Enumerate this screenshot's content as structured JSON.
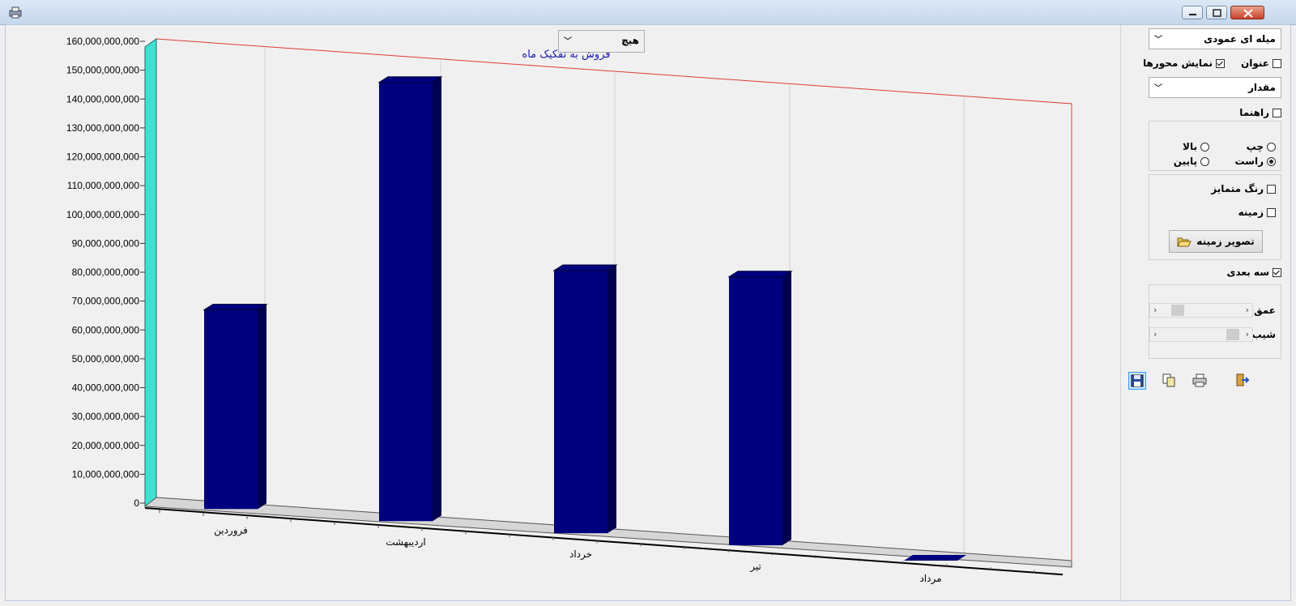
{
  "colors": {
    "bar": "#00007f",
    "bar_side": "#000050",
    "bar_top": "#00007f",
    "axis_wall": "#40e0d0",
    "outline": "#e03c31"
  },
  "window": {
    "icons": [
      "minimize-icon",
      "restore-icon",
      "close-icon"
    ]
  },
  "chart": {
    "group_dropdown": {
      "value": "هیچ"
    },
    "title": "فروش به تفکیک ماه"
  },
  "chart_data": {
    "type": "bar",
    "title": "فروش به تفکیک ماه",
    "categories": [
      "فروردین",
      "اردیبهشت",
      "خرداد",
      "تیر",
      "مرداد"
    ],
    "series": [
      {
        "values": [
          69000000000,
          152000000000,
          91000000000,
          93000000000,
          0
        ]
      }
    ],
    "yticks": [
      "0",
      "10,000,000,000",
      "20,000,000,000",
      "30,000,000,000",
      "40,000,000,000",
      "50,000,000,000",
      "60,000,000,000",
      "70,000,000,000",
      "80,000,000,000",
      "90,000,000,000",
      "100,000,000,000",
      "110,000,000,000",
      "120,000,000,000",
      "130,000,000,000",
      "140,000,000,000",
      "150,000,000,000",
      "160,000,000,000"
    ],
    "ylim": [
      0,
      160000000000
    ],
    "three_d": true,
    "grid": true
  },
  "panel": {
    "chart_type": "میله ای عمودی",
    "title_label": "عنوان",
    "title_checked": false,
    "show_axes_label": "نمایش محورها",
    "show_axes_checked": true,
    "label_type": "مقدار",
    "legend_label": "راهنما",
    "legend_checked": false,
    "pos_left": "چپ",
    "pos_right": "راست",
    "pos_top": "بالا",
    "pos_bottom": "پایین",
    "distinct_color_label": "رنگ متمایز",
    "background_label": "زمینه",
    "bg_image_button": "تصویر زمینه",
    "three_d_label": "سه بعدی",
    "three_d_checked": true,
    "depth_label": "عمق",
    "tilt_label": "شیب"
  }
}
